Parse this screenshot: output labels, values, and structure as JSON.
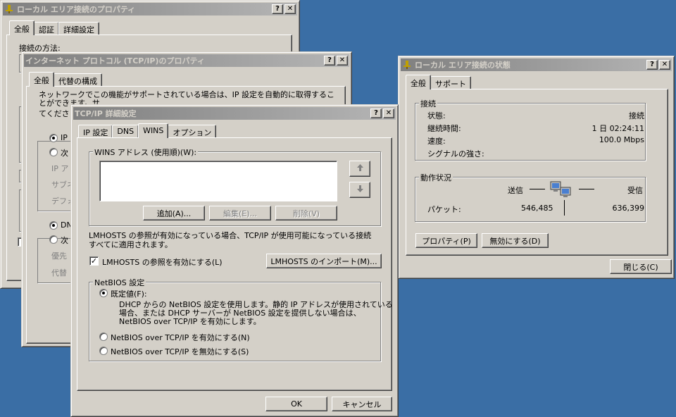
{
  "win_props": {
    "title": "ローカル エリア接続のプロパティ",
    "tabs": [
      "全般",
      "認証",
      "詳細設定"
    ],
    "connect_using": "接続の方法:"
  },
  "win_tcpip": {
    "title": "インターネット プロトコル (TCP/IP)のプロパティ",
    "tabs": [
      "全般",
      "代替の構成"
    ],
    "intro": "ネットワークでこの機能がサポートされている場合は、IP 設定を自動的に取得することができます。サ",
    "intro2": "てください",
    "ip_radio1": "IP",
    "ip_radio2": "次",
    "ip_addr": "IP ア",
    "subnet": "サブネ",
    "gateway": "デフォ",
    "dns_radio1": "DN",
    "dns_radio2": "次",
    "preferred": "優先",
    "alternate": "代替"
  },
  "win_adv": {
    "title": "TCP/IP 詳細設定",
    "tabs": [
      "IP 設定",
      "DNS",
      "WINS",
      "オプション"
    ],
    "wins_group": "WINS アドレス (使用順)(W):",
    "add": "追加(A)...",
    "edit": "編集(E)...",
    "remove": "削除(V)",
    "lmhosts_desc": "LMHOSTS の参照が有効になっている場合、TCP/IP が使用可能になっている接続すべてに適用されます。",
    "lmhosts_check": "LMHOSTS の参照を有効にする(L)",
    "lmhosts_import": "LMHOSTS のインポート(M)...",
    "netbios_group": "NetBIOS 設定",
    "opt_default": "既定値(F):",
    "opt_default_desc1": "DHCP からの NetBIOS 設定を使用します。静的 IP アドレスが使用されている",
    "opt_default_desc2": "場合、または DHCP サーバーが NetBIOS 設定を提供しない場合は、",
    "opt_default_desc3": "NetBIOS over TCP/IP を有効にします。",
    "opt_enable": "NetBIOS over TCP/IP を有効にする(N)",
    "opt_disable": "NetBIOS over TCP/IP を無効にする(S)",
    "ok": "OK",
    "cancel": "キャンセル"
  },
  "win_status": {
    "title": "ローカル エリア接続の状態",
    "tabs": [
      "全般",
      "サポート"
    ],
    "conn_group": "接続",
    "status_label": "状態:",
    "status_value": "接続",
    "duration_label": "継続時間:",
    "duration_value": "1 日 02:24:11",
    "speed_label": "速度:",
    "speed_value": "100.0 Mbps",
    "signal_label": "シグナルの強さ:",
    "activity_group": "動作状況",
    "sent_label": "送信",
    "recv_label": "受信",
    "packets_label": "パケット:",
    "sent_packets": "546,485",
    "recv_packets": "636,399",
    "properties": "プロパティ(P)",
    "disable": "無効にする(D)",
    "close": "閉じる(C)"
  },
  "titlebar_buttons": {
    "help": "?",
    "close": "✕"
  },
  "icons": {
    "up": "arrow-up-icon",
    "down": "arrow-down-icon",
    "network": "network-activity-icon"
  },
  "colors": {
    "desktop": "#3a6ea5",
    "face": "#d4d0c8",
    "active_title": "#0a246a",
    "inactive_title": "#808080"
  }
}
